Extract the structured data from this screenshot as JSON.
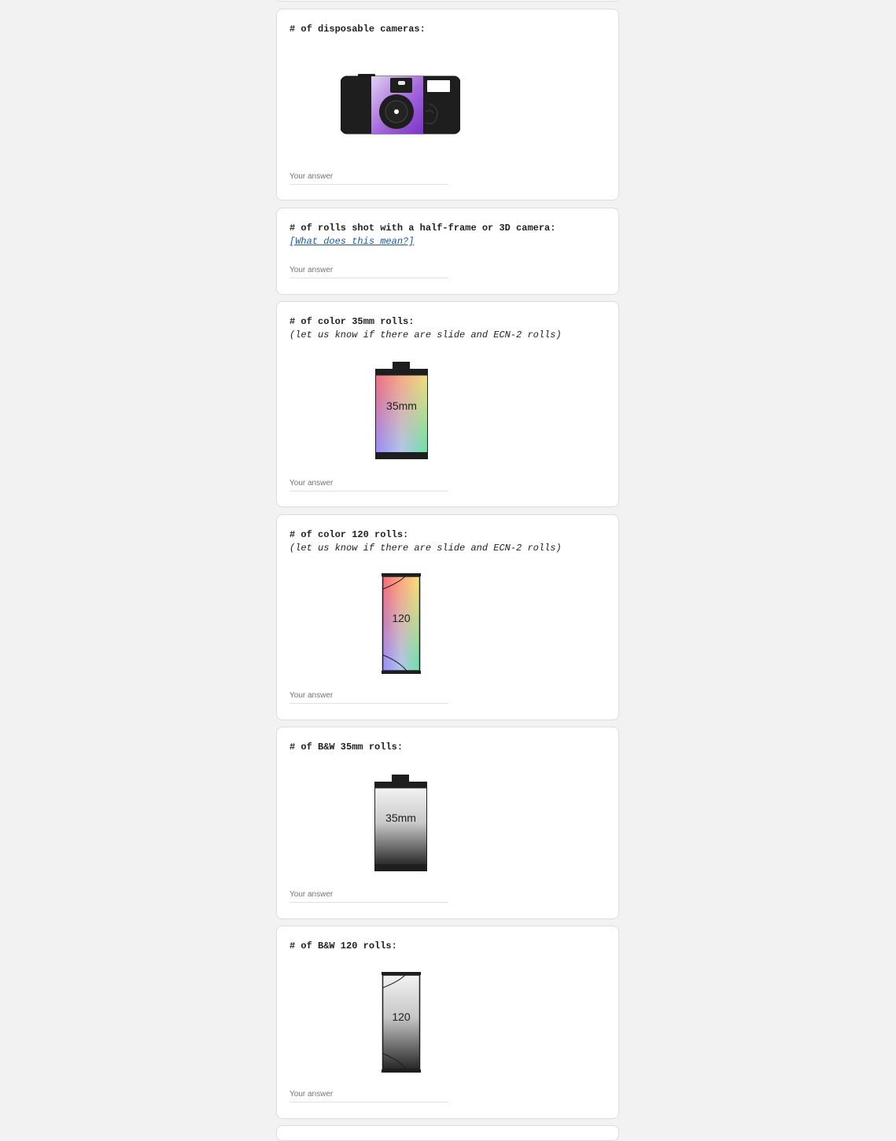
{
  "questions": [
    {
      "id": "disposable",
      "title": "# of disposable cameras:",
      "placeholder": "Your answer",
      "image": "disposable-camera-icon"
    },
    {
      "id": "half_frame",
      "title": "# of rolls shot with a half-frame or 3D camera:",
      "link": "[What does this mean?]",
      "placeholder": "Your answer"
    },
    {
      "id": "color_35",
      "title": "# of color 35mm rolls:",
      "subtitle": "(let us know if there are slide and ECN-2 rolls)",
      "placeholder": "Your answer",
      "image": "film-canister-35mm-color-icon",
      "image_label": "35mm"
    },
    {
      "id": "color_120",
      "title": "# of color 120 rolls:",
      "subtitle": "(let us know if there are slide and ECN-2 rolls)",
      "placeholder": "Your answer",
      "image": "film-roll-120-color-icon",
      "image_label": "120"
    },
    {
      "id": "bw_35",
      "title": "# of B&W 35mm rolls:",
      "placeholder": "Your answer",
      "image": "film-canister-35mm-bw-icon",
      "image_label": "35mm"
    },
    {
      "id": "bw_120",
      "title": "# of B&W 120 rolls:",
      "placeholder": "Your answer",
      "image": "film-roll-120-bw-icon",
      "image_label": "120"
    }
  ],
  "colors": {
    "page_background": "#f2f2f2",
    "card_background": "#ffffff",
    "card_border": "#dadce0",
    "link": "#1a57b5",
    "camera_purple": "#9b5fd6"
  }
}
